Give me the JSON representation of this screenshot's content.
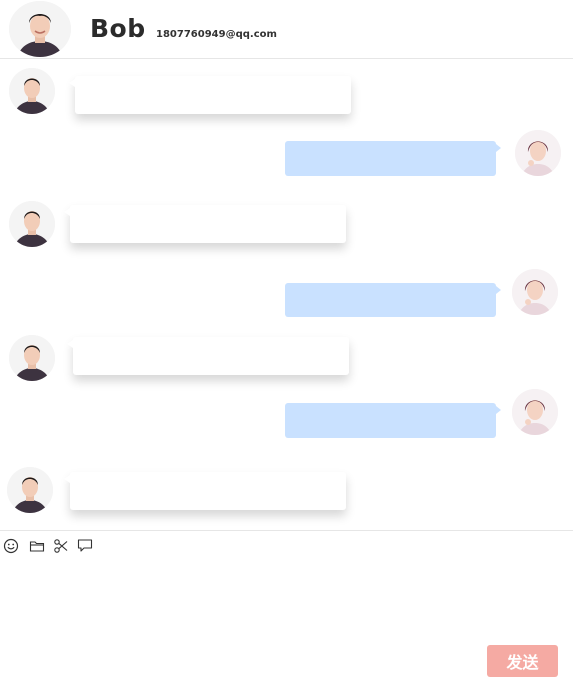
{
  "header": {
    "name": "Bob",
    "email": "1807760949@qq.com"
  },
  "messages": [
    {
      "side": "left",
      "text": ""
    },
    {
      "side": "right",
      "text": ""
    },
    {
      "side": "left",
      "text": ""
    },
    {
      "side": "right",
      "text": ""
    },
    {
      "side": "left",
      "text": ""
    },
    {
      "side": "right",
      "text": ""
    },
    {
      "side": "left",
      "text": ""
    }
  ],
  "toolbar": {
    "icons": [
      "smile-icon",
      "folder-icon",
      "scissors-icon",
      "chat-icon"
    ]
  },
  "composer": {
    "value": "",
    "send_label": "发送"
  },
  "colors": {
    "own_bubble": "#c9e1ff",
    "other_bubble": "#ffffff",
    "send_button": "#f5aaa3"
  }
}
